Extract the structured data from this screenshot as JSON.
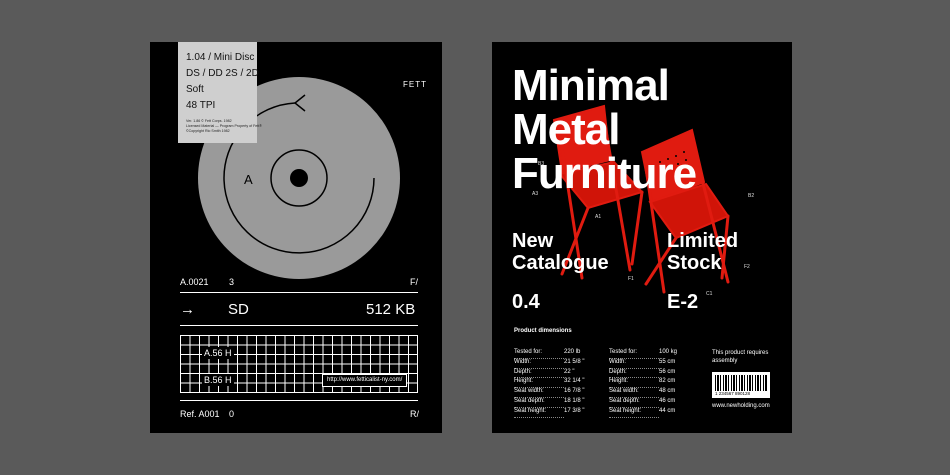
{
  "left_poster": {
    "card": {
      "lines": [
        "1.04 / Mini Disc",
        "DS / DD  2S / 2D",
        "Soft",
        "48 TPI"
      ],
      "small": [
        "Ver. 1.86 © Fett Corps. 1982",
        "Licensed Material — Program Property of Fett®",
        "©Copyright  Rio Smith 1982"
      ]
    },
    "brand": "FETT",
    "disc_side": "A",
    "row1": {
      "ref": "A.0021",
      "num": "3",
      "mark": "F/"
    },
    "row2": {
      "arrow": "→",
      "mode": "SD",
      "size": "512 KB"
    },
    "grid": {
      "label1": "A.56 H",
      "label2": "B.56 H",
      "url": "http://www.fetticalist-ny.com/"
    },
    "row3": {
      "ref": "Ref. A001",
      "num": "0",
      "mark": "R/"
    }
  },
  "right_poster": {
    "headline": [
      "Minimal",
      "Metal",
      "Furniture"
    ],
    "left_sub": [
      "New",
      "Catalogue"
    ],
    "right_sub": [
      "Limited",
      "Stock"
    ],
    "left_code": "0.4",
    "right_code": "E-2",
    "markers": {
      "b3": "B3",
      "a3": "A3",
      "a1": "A1",
      "b2": "B2",
      "f1": "F1",
      "f2": "F2",
      "c1": "C1"
    },
    "dims_title": "Product dimensions",
    "specs_left": [
      {
        "label": "Tested for:",
        "value": "220 lb"
      },
      {
        "label": "Width:",
        "value": "21 5/8 \""
      },
      {
        "label": "Depth:",
        "value": "22 \""
      },
      {
        "label": "Height:",
        "value": "32 1/4 \""
      },
      {
        "label": "Seat width:",
        "value": "16 7/8 \""
      },
      {
        "label": "Seat depth:",
        "value": "18 1/8 \""
      },
      {
        "label": "Seat height:",
        "value": "17 3/8 \""
      }
    ],
    "specs_right": [
      {
        "label": "Tested for:",
        "value": "100 kg"
      },
      {
        "label": "Width:",
        "value": "55 cm"
      },
      {
        "label": "Depth:",
        "value": "56 cm"
      },
      {
        "label": "Height:",
        "value": "82 cm"
      },
      {
        "label": "Seat width:",
        "value": "48 cm"
      },
      {
        "label": "Seat depth:",
        "value": "46 cm"
      },
      {
        "label": "Seat height:",
        "value": "44 cm"
      }
    ],
    "note": [
      "This product requires",
      "assembly"
    ],
    "barcode_digits": "1 234567 890128",
    "website": "www.newholding.com"
  },
  "colors": {
    "background": "#5a5a5a",
    "poster": "#000000",
    "disc": "#9a9a9a",
    "chair": "#e01b10"
  }
}
